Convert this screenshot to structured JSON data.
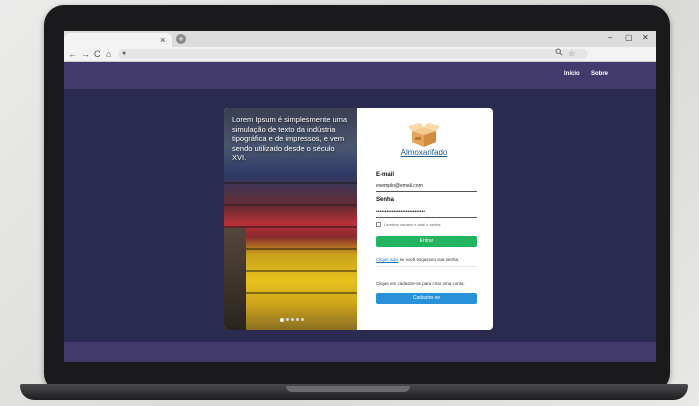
{
  "browser": {
    "tab_close": "×",
    "new_tab": "+",
    "window_controls": [
      "–",
      "▢",
      "✕"
    ],
    "nav_icons": [
      "←",
      "→",
      "C",
      "⌂"
    ],
    "omnibox_icons": [
      "search-icon",
      "star-icon"
    ]
  },
  "site": {
    "nav": [
      {
        "label": "Início"
      },
      {
        "label": "Sobre"
      }
    ]
  },
  "carousel": {
    "caption": "Lorem Ipsum é simplesmente uma simulação de texto da indústria tipográfica e de impressos, e vem sendo utilizado desde o século XVI.",
    "slide_count": 5,
    "active_index": 0
  },
  "login": {
    "brand": "Almoxarifado",
    "email_label": "E-mail",
    "email_value": "exemplo@email.com",
    "password_label": "Senha",
    "password_value": "••••••••••••••••••••••••••••",
    "remember_label": "Lembrar usuário e-mail e senha",
    "submit_label": "Entrar",
    "forgot_link": "Clique aqui",
    "forgot_text": " se você esqueceu sua senha.",
    "register_hint": "Clique em cadastre-se para criar uma conta.",
    "register_label": "Cadastre-se"
  },
  "colors": {
    "header": "#433a6c",
    "background": "#2b2a50",
    "enter_button": "#23b45f",
    "register_button": "#2791da"
  }
}
